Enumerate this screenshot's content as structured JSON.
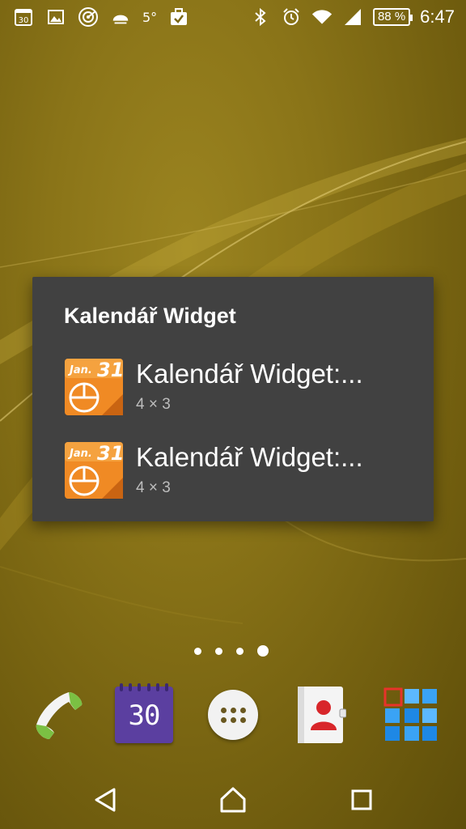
{
  "status_bar": {
    "icons_left": [
      "calendar-30-icon",
      "gallery-icon",
      "radar-icon",
      "weather-cloud-icon",
      "briefcase-check-icon"
    ],
    "calendar_day": "30",
    "temperature": "5°",
    "icons_right": [
      "bluetooth-icon",
      "alarm-icon",
      "wifi-icon",
      "signal-icon",
      "battery-icon"
    ],
    "battery": "88 %",
    "time": "6:47"
  },
  "widget_picker": {
    "title": "Kalendář Widget",
    "items": [
      {
        "title": "Kalendář Widget:...",
        "size": "4 × 3",
        "icon": "calendar-widget-icon",
        "icon_month": "Jan.",
        "icon_day": "31"
      },
      {
        "title": "Kalendář Widget:...",
        "size": "4 × 3",
        "icon": "calendar-widget-icon",
        "icon_month": "Jan.",
        "icon_day": "31"
      }
    ]
  },
  "home_pages": {
    "count": 4,
    "active_index": 3
  },
  "dock": {
    "apps": [
      {
        "name": "phone",
        "icon": "phone-icon"
      },
      {
        "name": "calendar",
        "icon": "calendar-icon",
        "day": "30"
      },
      {
        "name": "app-drawer",
        "icon": "apps-grid-icon"
      },
      {
        "name": "contacts",
        "icon": "contacts-icon"
      },
      {
        "name": "album",
        "icon": "album-tiles-icon"
      }
    ]
  },
  "nav_bar": {
    "buttons": [
      "back-icon",
      "home-icon",
      "recent-apps-icon"
    ]
  },
  "colors": {
    "wallpaper": "#8a7418",
    "dialog_bg": "#414141",
    "secondary_text": "#bdbdbd",
    "calendar_purple": "#5b3fa0",
    "widget_orange": "#f08a24"
  }
}
